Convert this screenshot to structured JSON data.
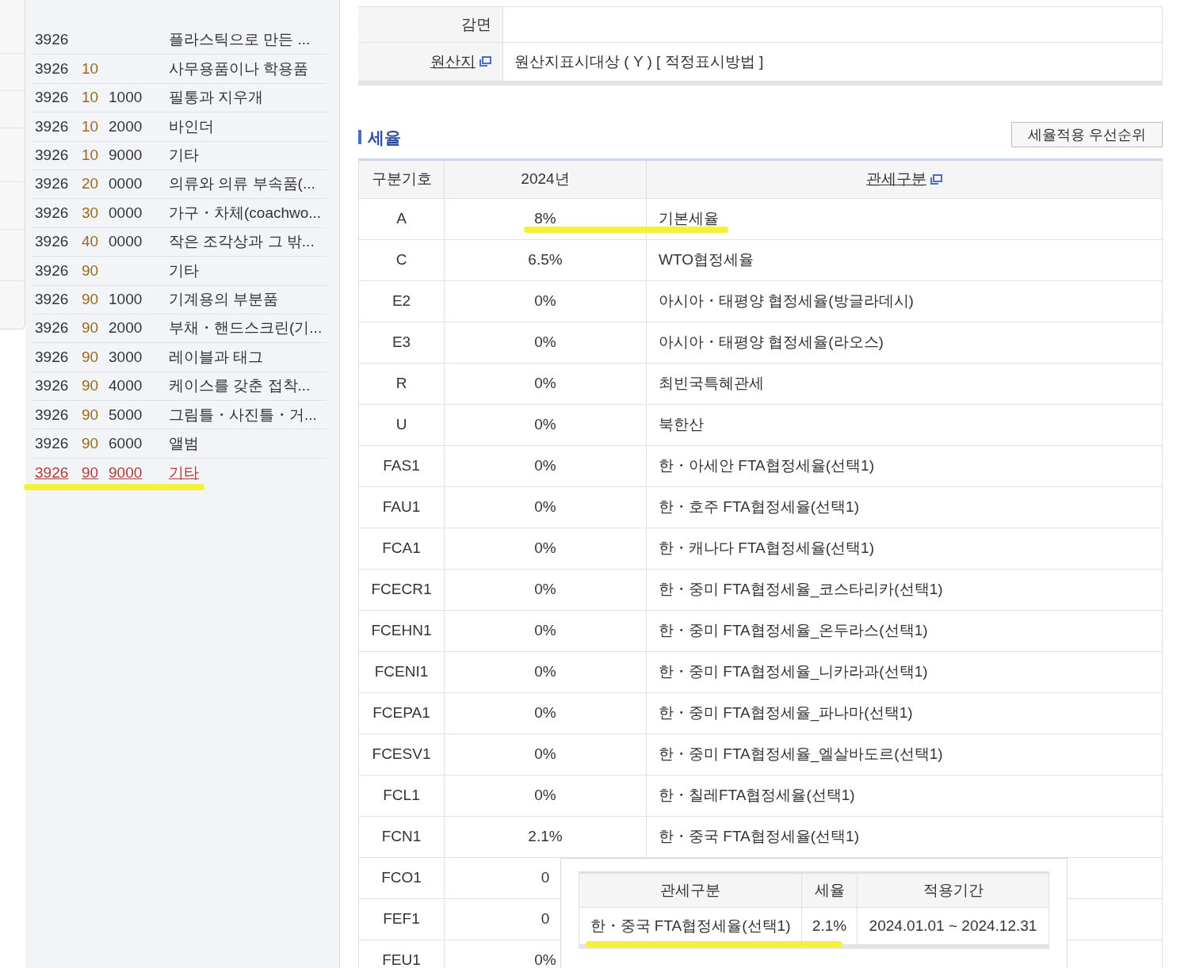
{
  "hs_list": [
    {
      "heading": "3926",
      "description": "플라스틱으로 만든 ...",
      "selected": false,
      "highlighted": false
    },
    {
      "heading": "3926",
      "sub": "10",
      "description": "사무용품이나 학용품",
      "selected": false,
      "highlighted": false
    },
    {
      "heading": "3926",
      "sub": "10",
      "code": "1000",
      "description": "필통과 지우개",
      "selected": false,
      "highlighted": false
    },
    {
      "heading": "3926",
      "sub": "10",
      "code": "2000",
      "description": "바인더",
      "selected": false,
      "highlighted": false
    },
    {
      "heading": "3926",
      "sub": "10",
      "code": "9000",
      "description": "기타",
      "selected": false,
      "highlighted": false
    },
    {
      "heading": "3926",
      "sub": "20",
      "code": "0000",
      "description": "의류와 의류 부속품(...",
      "selected": false,
      "highlighted": false
    },
    {
      "heading": "3926",
      "sub": "30",
      "code": "0000",
      "description": "가구・차체(coachwo...",
      "selected": false,
      "highlighted": false
    },
    {
      "heading": "3926",
      "sub": "40",
      "code": "0000",
      "description": "작은 조각상과 그 밖...",
      "selected": false,
      "highlighted": false
    },
    {
      "heading": "3926",
      "sub": "90",
      "description": "기타",
      "selected": false,
      "highlighted": false
    },
    {
      "heading": "3926",
      "sub": "90",
      "code": "1000",
      "description": "기계용의 부분품",
      "selected": false,
      "highlighted": false
    },
    {
      "heading": "3926",
      "sub": "90",
      "code": "2000",
      "description": "부채・핸드스크린(기...",
      "selected": false,
      "highlighted": false
    },
    {
      "heading": "3926",
      "sub": "90",
      "code": "3000",
      "description": "레이블과 태그",
      "selected": false,
      "highlighted": false
    },
    {
      "heading": "3926",
      "sub": "90",
      "code": "4000",
      "description": "케이스를 갖춘 접착...",
      "selected": false,
      "highlighted": false
    },
    {
      "heading": "3926",
      "sub": "90",
      "code": "5000",
      "description": "그림틀・사진틀・거...",
      "selected": false,
      "highlighted": false
    },
    {
      "heading": "3926",
      "sub": "90",
      "code": "6000",
      "description": "앨범",
      "selected": false,
      "highlighted": false
    },
    {
      "heading": "3926",
      "sub": "90",
      "code": "9000",
      "description": "기타",
      "selected": true,
      "highlighted": true
    }
  ],
  "info_table": [
    {
      "label": "감면",
      "link": false
    },
    {
      "label": "원산지",
      "link": true,
      "value": "원산지표시대상 ( Y ) [ 적정표시방법 ]"
    }
  ],
  "tax_section": {
    "title": "세율",
    "button": "세율적용 우선순위",
    "columns": [
      "구분기호",
      "2024년",
      "관세구분"
    ],
    "rows": [
      {
        "code": "A",
        "rate": "8%",
        "type": "기본세율",
        "highlighted": true
      },
      {
        "code": "C",
        "rate": "6.5%",
        "type": "WTO협정세율",
        "highlighted": false
      },
      {
        "code": "E2",
        "rate": "0%",
        "type": "아시아・태평양 협정세율(방글라데시)",
        "highlighted": false
      },
      {
        "code": "E3",
        "rate": "0%",
        "type": "아시아・태평양 협정세율(라오스)",
        "highlighted": false
      },
      {
        "code": "R",
        "rate": "0%",
        "type": "최빈국특혜관세",
        "highlighted": false
      },
      {
        "code": "U",
        "rate": "0%",
        "type": "북한산",
        "highlighted": false
      },
      {
        "code": "FAS1",
        "rate": "0%",
        "type": "한・아세안 FTA협정세율(선택1)",
        "highlighted": false
      },
      {
        "code": "FAU1",
        "rate": "0%",
        "type": "한・호주 FTA협정세율(선택1)",
        "highlighted": false
      },
      {
        "code": "FCA1",
        "rate": "0%",
        "type": "한・캐나다 FTA협정세율(선택1)",
        "highlighted": false
      },
      {
        "code": "FCECR1",
        "rate": "0%",
        "type": "한・중미 FTA협정세율_코스타리카(선택1)",
        "highlighted": false
      },
      {
        "code": "FCEHN1",
        "rate": "0%",
        "type": "한・중미 FTA협정세율_온두라스(선택1)",
        "highlighted": false
      },
      {
        "code": "FCENI1",
        "rate": "0%",
        "type": "한・중미 FTA협정세율_니카라과(선택1)",
        "highlighted": false
      },
      {
        "code": "FCEPA1",
        "rate": "0%",
        "type": "한・중미 FTA협정세율_파나마(선택1)",
        "highlighted": false
      },
      {
        "code": "FCESV1",
        "rate": "0%",
        "type": "한・중미 FTA협정세율_엘살바도르(선택1)",
        "highlighted": false
      },
      {
        "code": "FCL1",
        "rate": "0%",
        "type": "한・칠레FTA협정세율(선택1)",
        "highlighted": false
      },
      {
        "code": "FCN1",
        "rate": "2.1%",
        "type": "한・중국 FTA협정세율(선택1)",
        "highlighted": false
      },
      {
        "code": "FCO1",
        "rate": "0",
        "highlighted": false
      },
      {
        "code": "FEF1",
        "rate": "0",
        "highlighted": false
      },
      {
        "code": "FEU1",
        "rate": "0%",
        "highlighted": false
      }
    ]
  },
  "popup": {
    "columns": [
      "관세구분",
      "세율",
      "적용기간"
    ],
    "rows": [
      {
        "type": "한・중국 FTA협정세율(선택1)",
        "rate": "2.1%",
        "period": "2024.01.01 ~ 2024.12.31",
        "highlighted": true
      }
    ]
  }
}
